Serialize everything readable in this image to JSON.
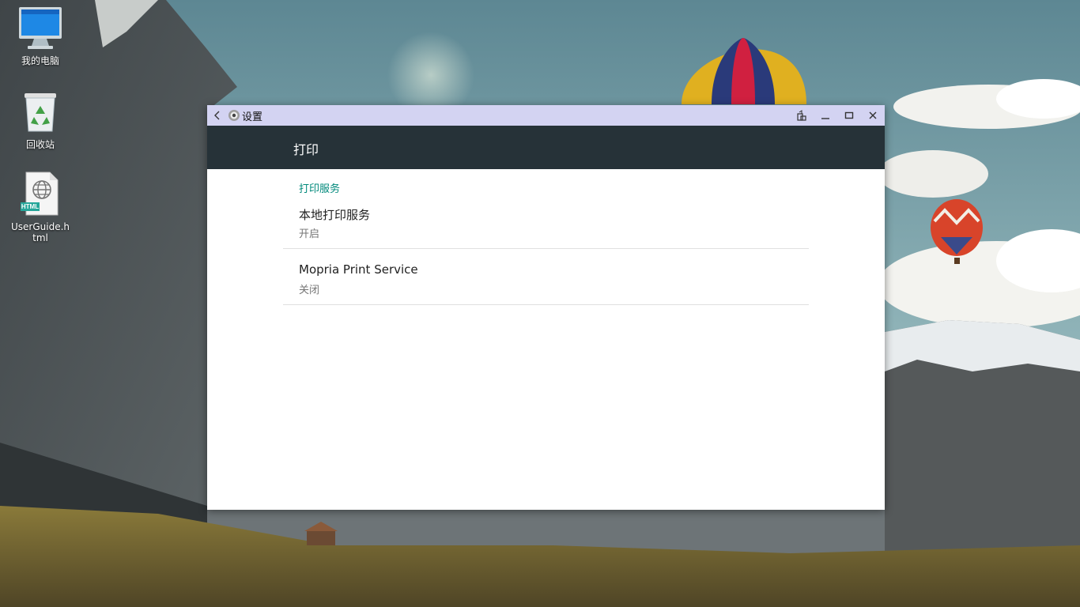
{
  "desktop": {
    "icons": [
      {
        "label": "我的电脑",
        "icon": "computer-icon"
      },
      {
        "label": "回收站",
        "icon": "recycle-bin-icon"
      },
      {
        "label": "UserGuide.html",
        "icon": "html-file-icon",
        "badge": "HTML"
      }
    ]
  },
  "window": {
    "title": "设置",
    "app_icon": "settings-gear-icon",
    "controls": [
      "rotate-icon",
      "minimize-icon",
      "maximize-icon",
      "close-icon"
    ],
    "appbar_title": "打印",
    "section_header": "打印服务",
    "items": [
      {
        "title": "本地打印服务",
        "summary": "开启"
      },
      {
        "title": "Mopria Print Service",
        "summary": "关闭"
      }
    ]
  },
  "colors": {
    "titlebar": "#d3d3f2",
    "appbar": "#263238",
    "accent": "#00897b"
  }
}
